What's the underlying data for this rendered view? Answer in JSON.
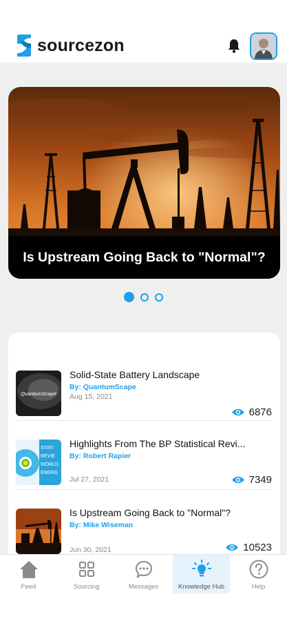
{
  "app": {
    "brand": "sourcezon",
    "brand_color": "#1ea0e8"
  },
  "header": {
    "bell_icon": "bell-icon",
    "avatar": "user-avatar"
  },
  "hero": {
    "title": "Is Upstream Going Back to \"Normal\"?",
    "pages": 3,
    "active_page": 1
  },
  "articles": [
    {
      "title": "Solid-State Battery Landscape",
      "author": "By: QuantumScape",
      "date": "Aug 15, 2021",
      "views": "6876",
      "thumb_text": "QuantumScape"
    },
    {
      "title": "Highlights From The BP Statistical Revi...",
      "author": "By: Robert Rapier",
      "date": "Jul 27, 2021",
      "views": "7349",
      "thumb_text": "STATI REVIE WORLD ENERG"
    },
    {
      "title": "Is Upstream Going Back to \"Normal\"?",
      "author": "By: Mike Wiseman",
      "date": "Jun 30, 2021",
      "views": "10523"
    }
  ],
  "tabs": [
    {
      "label": "Feed",
      "icon": "home-icon"
    },
    {
      "label": "Sourcing",
      "icon": "grid-icon"
    },
    {
      "label": "Messages",
      "icon": "chat-icon"
    },
    {
      "label": "Knowledge Hub",
      "icon": "lightbulb-icon",
      "active": true
    },
    {
      "label": "Help",
      "icon": "help-icon"
    }
  ]
}
